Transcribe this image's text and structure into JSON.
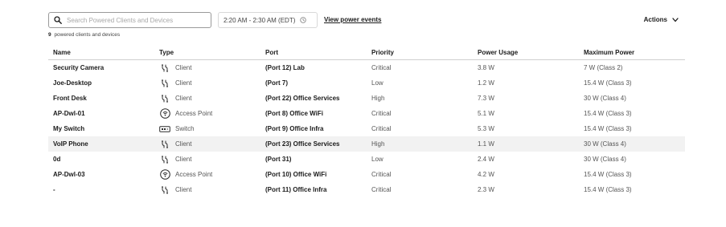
{
  "toolbar": {
    "search_placeholder": "Search Powered Clients and Devices",
    "time_range": "2:20 AM - 2:30 AM (EDT)",
    "view_link": "View power events",
    "actions_label": "Actions"
  },
  "summary": {
    "count": "9",
    "text": "powered clients and devices"
  },
  "table": {
    "columns": [
      "Name",
      "Type",
      "Port",
      "Priority",
      "Power Usage",
      "Maximum Power"
    ],
    "rows": [
      {
        "name": "Security Camera",
        "type": "Client",
        "icon": "client-icon",
        "port": "(Port 12) Lab",
        "priority": "Critical",
        "usage": "3.8 W",
        "max": "7 W (Class 2)"
      },
      {
        "name": "Joe-Desktop",
        "type": "Client",
        "icon": "client-icon",
        "port": "(Port 7)",
        "priority": "Low",
        "usage": "1.2 W",
        "max": "15.4 W (Class 3)"
      },
      {
        "name": "Front Desk",
        "type": "Client",
        "icon": "client-icon",
        "port": "(Port 22) Office Services",
        "priority": "High",
        "usage": "7.3 W",
        "max": "30 W (Class 4)"
      },
      {
        "name": "AP-Dwl-01",
        "type": "Access Point",
        "icon": "access-point-icon",
        "port": "(Port 8) Office WiFi",
        "priority": "Critical",
        "usage": "5.1 W",
        "max": "15.4 W (Class 3)"
      },
      {
        "name": "My Switch",
        "type": "Switch",
        "icon": "switch-icon",
        "port": "(Port 9) Office Infra",
        "priority": "Critical",
        "usage": "5.3 W",
        "max": "15.4 W (Class 3)"
      },
      {
        "name": "VoIP Phone",
        "type": "Client",
        "icon": "client-icon",
        "port": "(Port 23) Office Services",
        "priority": "High",
        "usage": "1.1 W",
        "max": "30 W (Class 4)"
      },
      {
        "name": "0d",
        "type": "Client",
        "icon": "client-icon",
        "port": "(Port 31)",
        "priority": "Low",
        "usage": "2.4 W",
        "max": "30 W (Class 4)"
      },
      {
        "name": "AP-Dwl-03",
        "type": "Access Point",
        "icon": "access-point-icon",
        "port": "(Port 10) Office WiFi",
        "priority": "Critical",
        "usage": "4.2 W",
        "max": "15.4 W (Class 3)"
      },
      {
        "name": "-",
        "type": "Client",
        "icon": "client-icon",
        "port": "(Port 11) Office Infra",
        "priority": "Critical",
        "usage": "2.3 W",
        "max": "15.4 W (Class 3)"
      }
    ]
  }
}
